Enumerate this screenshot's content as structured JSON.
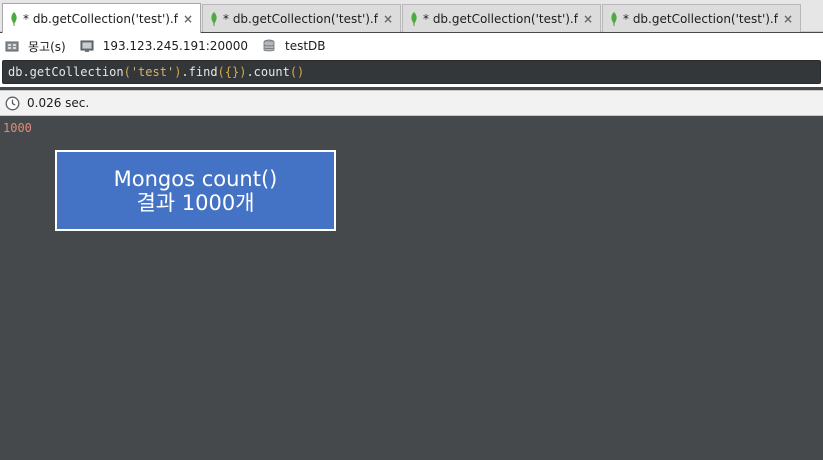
{
  "tabs": [
    {
      "label": "* db.getCollection('test').fi⋯",
      "active": true,
      "close_glyph": "×",
      "icon": "mongodb-leaf-icon"
    },
    {
      "label": "* db.getCollection('test').f⋯",
      "active": false,
      "close_glyph": "×",
      "icon": "mongodb-leaf-icon"
    },
    {
      "label": "* db.getCollection('test').f⋯",
      "active": false,
      "close_glyph": "×",
      "icon": "mongodb-leaf-icon"
    },
    {
      "label": "* db.getCollection('test').fi⋯",
      "active": false,
      "close_glyph": "×",
      "icon": "mongodb-leaf-icon"
    }
  ],
  "info": {
    "connection_name": "몽고(s)",
    "server_address": "193.123.245.191:20000",
    "database": "testDB"
  },
  "query": {
    "p1": "db.getCollection",
    "p2": "(",
    "p3": "'test'",
    "p4": ")",
    "p5": ".find",
    "p6": "({})",
    "p7": ".count",
    "p8": "()"
  },
  "status": {
    "elapsed": "0.026 sec."
  },
  "results": {
    "value": "1000"
  },
  "callout": {
    "line1": "Mongos count()",
    "line2": "결과 1000개"
  },
  "colors": {
    "leaf_green": "#4caa3f",
    "callout_blue": "#4472c4",
    "result_text": "#e08a7a",
    "results_bg": "#46494c"
  }
}
